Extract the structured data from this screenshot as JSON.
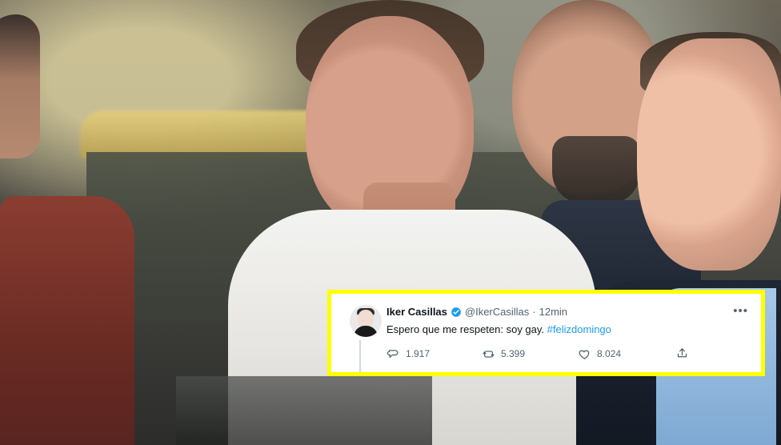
{
  "tweet": {
    "display_name": "Iker Casillas",
    "handle": "@IkerCasillas",
    "separator": "·",
    "time": "12min",
    "text": "Espero que me respeten: soy gay.",
    "hashtag": "#felizdomingo",
    "more": "•••",
    "metrics": {
      "reply": "1.917",
      "retweet": "5.399",
      "like": "8.024"
    },
    "icons": {
      "verified": "verified-badge-icon",
      "reply": "reply-icon",
      "retweet": "retweet-icon",
      "like": "heart-icon",
      "share": "share-icon",
      "more": "more-icon"
    }
  },
  "colors": {
    "highlight_border": "#ffff00",
    "twitter_blue": "#1d9bf0",
    "text_primary": "#0f1419",
    "text_secondary": "#536471"
  }
}
